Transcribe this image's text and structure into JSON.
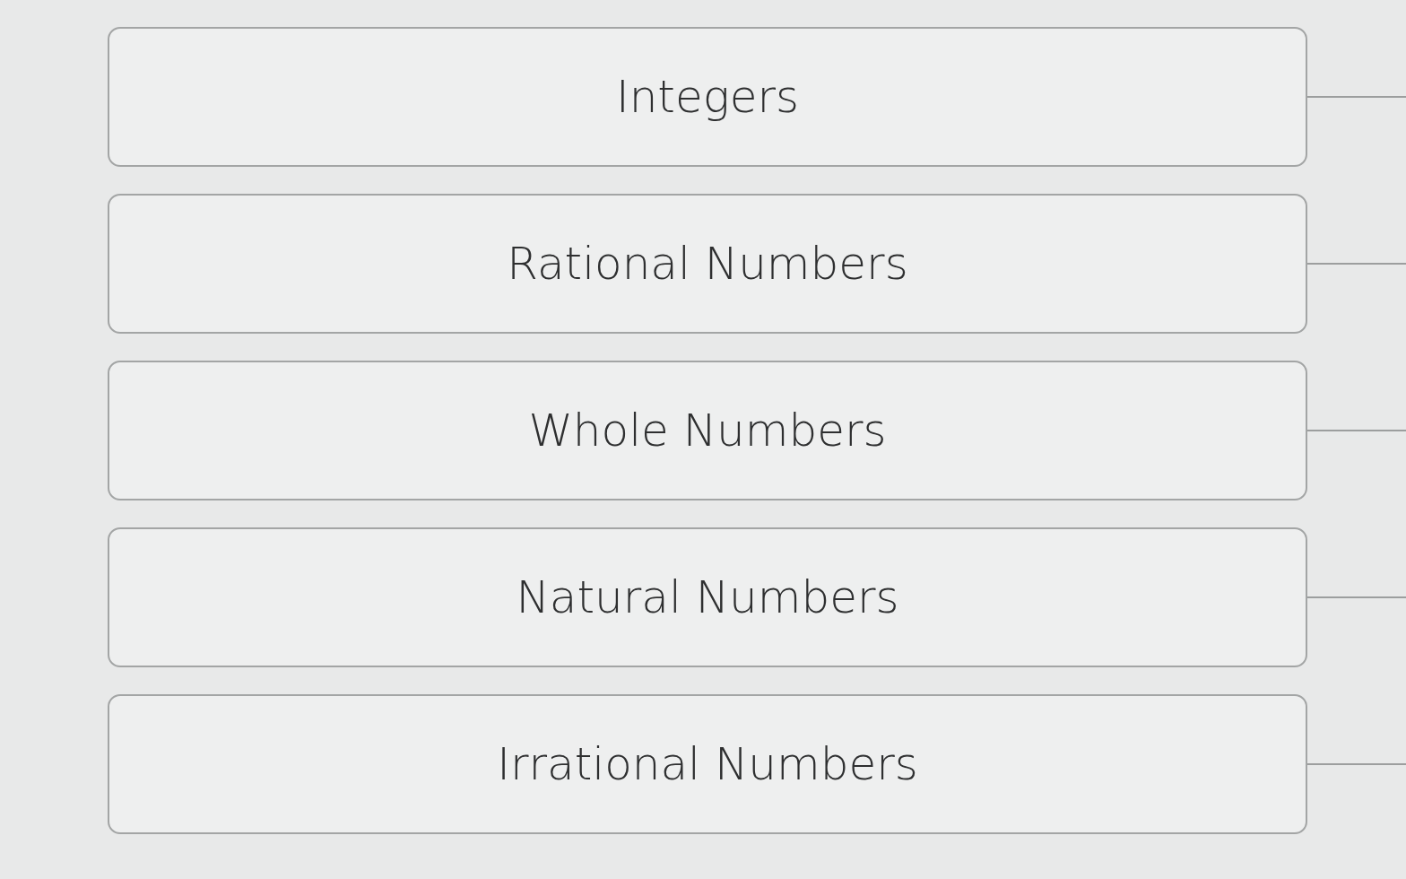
{
  "options": [
    "Integers",
    "Rational Numbers",
    "Whole Numbers",
    "Natural Numbers",
    "Irrational Numbers"
  ]
}
